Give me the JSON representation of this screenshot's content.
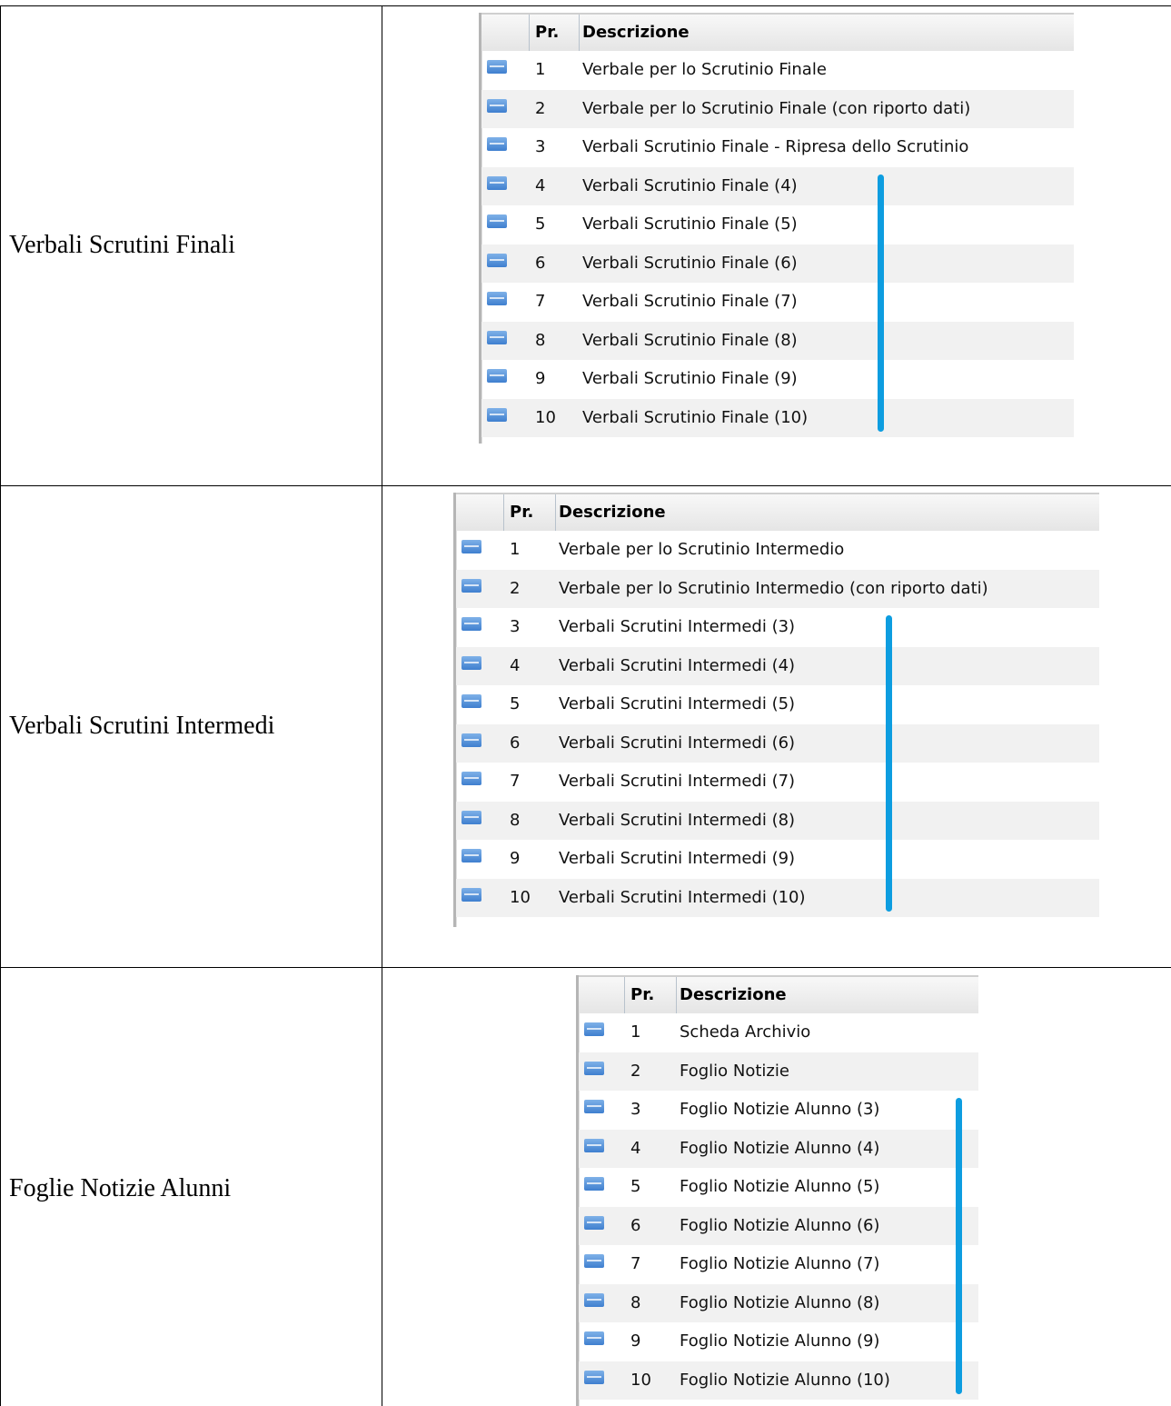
{
  "sections": [
    {
      "label": "Verbali Scrutini Finali",
      "header": {
        "pr": "Pr.",
        "desc": "Descrizione"
      },
      "rows": [
        {
          "num": "1",
          "desc": "Verbale per lo Scrutinio Finale"
        },
        {
          "num": "2",
          "desc": "Verbale per lo Scrutinio Finale (con riporto dati)"
        },
        {
          "num": "3",
          "desc": "Verbali Scrutinio Finale - Ripresa dello Scrutinio"
        },
        {
          "num": "4",
          "desc": "Verbali Scrutinio Finale (4)"
        },
        {
          "num": "5",
          "desc": "Verbali Scrutinio Finale (5)"
        },
        {
          "num": "6",
          "desc": "Verbali Scrutinio Finale (6)"
        },
        {
          "num": "7",
          "desc": "Verbali Scrutinio Finale (7)"
        },
        {
          "num": "8",
          "desc": "Verbali Scrutinio Finale (8)"
        },
        {
          "num": "9",
          "desc": "Verbali Scrutinio Finale (9)"
        },
        {
          "num": "10",
          "desc": "Verbali Scrutinio Finale (10)"
        }
      ]
    },
    {
      "label": "Verbali Scrutini Intermedi",
      "header": {
        "pr": "Pr.",
        "desc": "Descrizione"
      },
      "rows": [
        {
          "num": "1",
          "desc": "Verbale per lo Scrutinio Intermedio"
        },
        {
          "num": "2",
          "desc": "Verbale per lo Scrutinio Intermedio (con riporto dati)"
        },
        {
          "num": "3",
          "desc": "Verbali Scrutini Intermedi (3)"
        },
        {
          "num": "4",
          "desc": "Verbali Scrutini Intermedi (4)"
        },
        {
          "num": "5",
          "desc": "Verbali Scrutini Intermedi (5)"
        },
        {
          "num": "6",
          "desc": "Verbali Scrutini Intermedi (6)"
        },
        {
          "num": "7",
          "desc": "Verbali Scrutini Intermedi (7)"
        },
        {
          "num": "8",
          "desc": "Verbali Scrutini Intermedi (8)"
        },
        {
          "num": "9",
          "desc": "Verbali Scrutini Intermedi (9)"
        },
        {
          "num": "10",
          "desc": "Verbali Scrutini Intermedi (10)"
        }
      ]
    },
    {
      "label": "Foglie Notizie Alunni",
      "header": {
        "pr": "Pr.",
        "desc": "Descrizione"
      },
      "rows": [
        {
          "num": "1",
          "desc": "Scheda Archivio"
        },
        {
          "num": "2",
          "desc": "Foglio Notizie"
        },
        {
          "num": "3",
          "desc": "Foglio Notizie Alunno (3)"
        },
        {
          "num": "4",
          "desc": "Foglio Notizie Alunno (4)"
        },
        {
          "num": "5",
          "desc": "Foglio Notizie Alunno (5)"
        },
        {
          "num": "6",
          "desc": "Foglio Notizie Alunno (6)"
        },
        {
          "num": "7",
          "desc": "Foglio Notizie Alunno (7)"
        },
        {
          "num": "8",
          "desc": "Foglio Notizie Alunno (8)"
        },
        {
          "num": "9",
          "desc": "Foglio Notizie Alunno (9)"
        },
        {
          "num": "10",
          "desc": "Foglio Notizie Alunno (10)"
        }
      ]
    }
  ],
  "icons": {
    "row_icon": "html-file-icon"
  },
  "colors": {
    "bracket": "#0d9de0",
    "alt_row": "#f1f1f1"
  }
}
